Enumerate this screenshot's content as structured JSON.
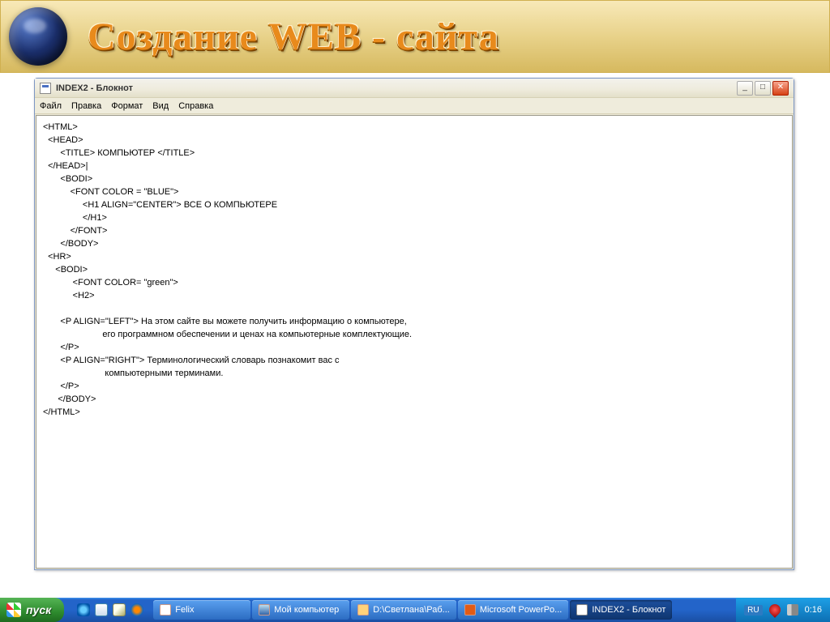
{
  "banner": {
    "title": "Создание WEB - сайта"
  },
  "window": {
    "title": "INDEX2 - Блокнот",
    "menus": {
      "file": "Файл",
      "edit": "Правка",
      "format": "Формат",
      "view": "Вид",
      "help": "Справка"
    },
    "buttons": {
      "minimize": "_",
      "maximize": "□",
      "close": "✕"
    }
  },
  "editor_code": "<HTML>\n  <HEAD>\n       <TITLE> КОМПЬЮТЕР </TITLE>\n  </HEAD>|\n       <BODI>\n           <FONT COLOR = \"BLUE\">\n                <H1 ALIGN=\"CENTER\"> ВСЕ О КОМПЬЮТЕРЕ\n                </H1>\n           </FONT>\n       </BODY>\n  <HR>\n     <BODI>\n            <FONT COLOR= \"green\">\n            <H2>\n\n       <P ALIGN=\"LEFT\"> На этом сайте вы можете получить информацию о компьютере,\n                        его программном обеспечении и ценах на компьютерные комплектующие.\n       </P>\n       <P ALIGN=\"RIGHT\"> Терминологический словарь познакомит вас с\n                         компьютерными терминами.\n       </P>\n      </BODY>\n</HTML>",
  "taskbar": {
    "start": "пуск",
    "items": [
      {
        "label": "Felix",
        "icon": "paw",
        "active": false
      },
      {
        "label": "Мой компьютер",
        "icon": "mon",
        "active": false
      },
      {
        "label": "D:\\Светлана\\Раб...",
        "icon": "folder",
        "active": false
      },
      {
        "label": "Microsoft PowerPo...",
        "icon": "ppt",
        "active": false
      },
      {
        "label": "INDEX2 - Блокнот",
        "icon": "np",
        "active": true
      }
    ],
    "systray": {
      "lang": "RU",
      "time": "0:16"
    }
  }
}
